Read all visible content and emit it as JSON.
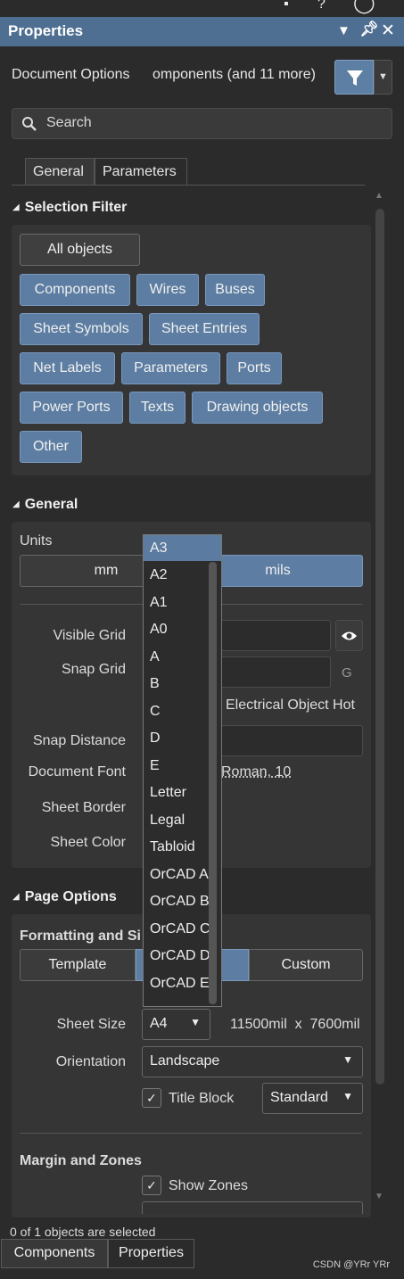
{
  "window": {
    "title": "Properties",
    "top_icons": [
      "pin-icon",
      "question-icon",
      "help-icon"
    ],
    "title_icons": [
      "dropdown-icon",
      "pin-icon",
      "close-icon"
    ]
  },
  "doc_options": {
    "label": "Document Options",
    "value": "omponents (and 11 more)"
  },
  "search": {
    "placeholder": "Search"
  },
  "tabs": [
    {
      "label": "General",
      "active": true
    },
    {
      "label": "Parameters",
      "active": false
    }
  ],
  "selection_filter": {
    "title": "Selection Filter",
    "buttons": [
      {
        "label": "All objects",
        "style": "grey"
      },
      {
        "label": "Components",
        "style": "blue"
      },
      {
        "label": "Wires",
        "style": "blue"
      },
      {
        "label": "Buses",
        "style": "blue"
      },
      {
        "label": "Sheet Symbols",
        "style": "blue"
      },
      {
        "label": "Sheet Entries",
        "style": "blue"
      },
      {
        "label": "Net Labels",
        "style": "blue"
      },
      {
        "label": "Parameters",
        "style": "blue"
      },
      {
        "label": "Ports",
        "style": "blue"
      },
      {
        "label": "Power Ports",
        "style": "blue"
      },
      {
        "label": "Texts",
        "style": "blue"
      },
      {
        "label": "Drawing objects",
        "style": "blue"
      },
      {
        "label": "Other",
        "style": "blue"
      }
    ]
  },
  "general": {
    "title": "General",
    "units_label": "Units",
    "units": [
      "mm",
      "mils"
    ],
    "units_selected": "mils",
    "visible_grid_label": "Visible Grid",
    "snap_grid_label": "Snap Grid",
    "snap_grid_shortcut": "G",
    "electrical_hotspot": "Electrical Object Hot",
    "snap_distance_label": "Snap Distance",
    "document_font_label": "Document Font",
    "document_font_value": "Roman, 10",
    "sheet_border_label": "Sheet Border",
    "sheet_color_label": "Sheet Color"
  },
  "sheet_size_dropdown": {
    "items": [
      "A3",
      "A2",
      "A1",
      "A0",
      "A",
      "B",
      "C",
      "D",
      "E",
      "Letter",
      "Legal",
      "Tabloid",
      "OrCAD A",
      "OrCAD B",
      "OrCAD C",
      "OrCAD D",
      "OrCAD E"
    ],
    "highlighted": "A3"
  },
  "page_options": {
    "title": "Page Options",
    "formatting_label": "Formatting and Si",
    "modes": [
      "Template",
      "",
      "Custom"
    ],
    "sheet_size_label": "Sheet Size",
    "sheet_size_value": "A4",
    "sheet_dimensions": "11500mil  x  7600mil",
    "orientation_label": "Orientation",
    "orientation_value": "Landscape",
    "title_block_label": "Title Block",
    "title_block_checked": true,
    "title_block_value": "Standard",
    "margin_zones_label": "Margin and Zones",
    "show_zones_label": "Show Zones",
    "show_zones_checked": true
  },
  "footer": {
    "status": "0 of 1 objects are selected",
    "tabs": [
      "Components",
      "Properties"
    ],
    "watermark": "CSDN @YRr YRr"
  },
  "colors": {
    "accent": "#5d7ea2",
    "titlebar": "#4f6f92",
    "background": "#2b2b2b",
    "panel": "#353535"
  }
}
